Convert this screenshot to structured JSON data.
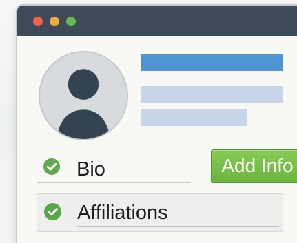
{
  "window": {
    "controls": [
      "close",
      "minimize",
      "maximize"
    ]
  },
  "profile": {
    "avatar_icon": "user-avatar-icon"
  },
  "fields": {
    "bio": {
      "label": "Bio",
      "icon": "check-icon",
      "button_label": "Add Info"
    },
    "affiliations": {
      "label": "Affiliations",
      "icon": "check-icon"
    }
  },
  "colors": {
    "titlebar": "#3d4b58",
    "accent_blue": "#4f95d2",
    "placeholder_blue": "#c7d6e8",
    "button_green": "#6bb43d"
  }
}
